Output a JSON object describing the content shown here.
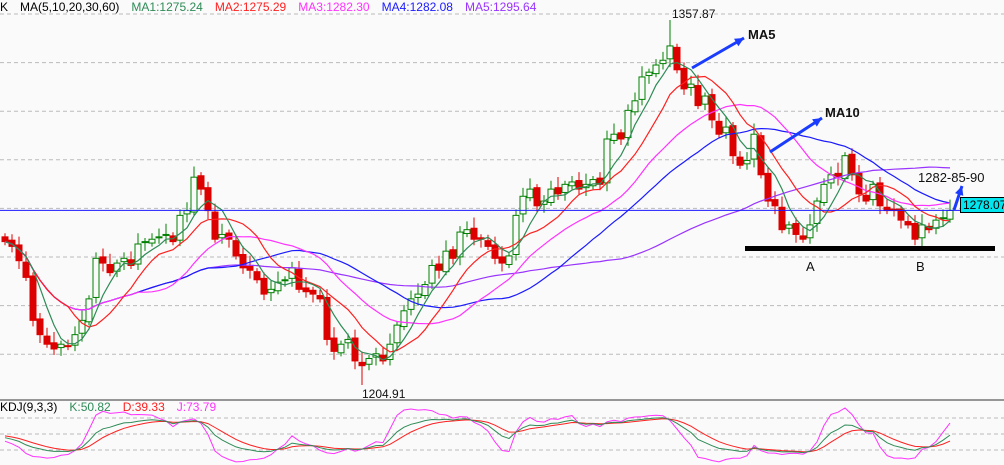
{
  "header": {
    "mode_label": "K",
    "ma_params": "MA(5,10,20,30,60)",
    "ma1": "MA1:1275.24",
    "ma2": "MA2:1275.29",
    "ma3": "MA3:1282.30",
    "ma4": "MA4:1282.08",
    "ma5": "MA5:1295.64"
  },
  "kdj_header": {
    "params": "KDJ(9,3,3)",
    "k": "K:50.82",
    "d": "D:39.33",
    "j": "J:73.79"
  },
  "annotations": {
    "high": "1357.87",
    "low": "1204.91",
    "ma5_arrow": "MA5",
    "ma10_arrow": "MA10",
    "target": "1282-85-90",
    "point_a": "A",
    "point_b": "B",
    "last_price": "1278.07"
  },
  "colors": {
    "up": "#008000",
    "down": "#dd0000",
    "ma1": "#2e8b57",
    "ma2": "#ff2020",
    "ma3": "#ff33ff",
    "ma4": "#1a1aff",
    "ma5": "#9933ff",
    "k": "#2e8b57",
    "d": "#ff2020",
    "j": "#ff33ff",
    "arrow": "#1a3cff",
    "tag": "#00e5ee"
  },
  "chart_data": {
    "type": "candlestick",
    "title": "",
    "ylim": [
      1204.91,
      1357.87
    ],
    "last_price": 1278.07,
    "ma_periods": [
      5,
      10,
      20,
      30,
      60
    ],
    "closes": [
      1265,
      1263,
      1257,
      1250,
      1232,
      1226,
      1222,
      1220,
      1222,
      1221,
      1226,
      1232,
      1241,
      1258,
      1256,
      1252,
      1256,
      1258,
      1255,
      1264,
      1265,
      1266,
      1267,
      1268,
      1265,
      1276,
      1278,
      1292,
      1287,
      1278,
      1266,
      1268,
      1266,
      1259,
      1254,
      1253,
      1249,
      1243,
      1245,
      1248,
      1249,
      1254,
      1245,
      1244,
      1243,
      1241,
      1224,
      1219,
      1222,
      1224,
      1215,
      1213,
      1216,
      1218,
      1215,
      1222,
      1230,
      1236,
      1241,
      1243,
      1247,
      1255,
      1253,
      1261,
      1258,
      1269,
      1270,
      1266,
      1266,
      1263,
      1258,
      1256,
      1259,
      1276,
      1284,
      1287,
      1280,
      1282,
      1287,
      1285,
      1289,
      1290,
      1287,
      1289,
      1291,
      1289,
      1308,
      1310,
      1308,
      1320,
      1324,
      1334,
      1336,
      1339,
      1341,
      1347,
      1337,
      1329,
      1331,
      1322,
      1326,
      1316,
      1310,
      1313,
      1301,
      1297,
      1299,
      1310,
      1293,
      1282,
      1280,
      1270,
      1272,
      1268,
      1266,
      1272,
      1282,
      1289,
      1293,
      1292,
      1301,
      1293,
      1285,
      1282,
      1289,
      1280,
      1278,
      1278,
      1274,
      1272,
      1266,
      1272,
      1270,
      1274,
      1275,
      1278.07
    ],
    "high_index": 95,
    "low_index": 51,
    "support_level_points": [
      "A",
      "B"
    ]
  }
}
